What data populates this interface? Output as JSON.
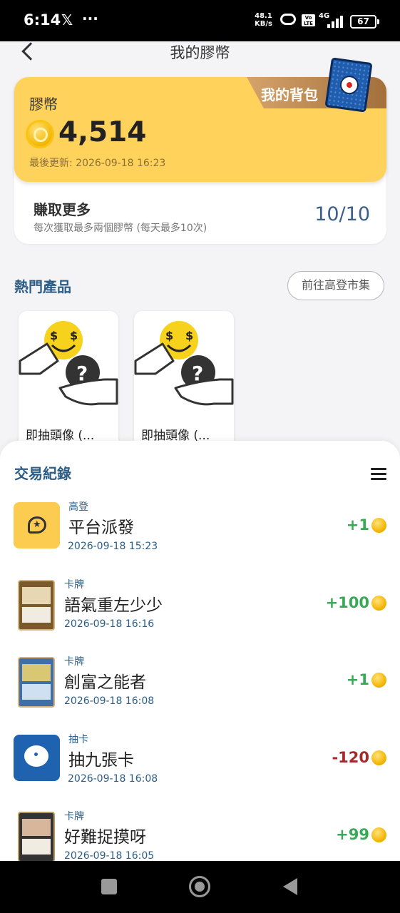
{
  "status_bar": {
    "time": "6:14",
    "net_speed": "48.1",
    "net_unit": "KB/s",
    "volte": "Vo LTE",
    "network": "4G",
    "battery": "67"
  },
  "header": {
    "title": "我的膠幣"
  },
  "coin_card": {
    "label": "膠幣",
    "balance": "4,514",
    "updated": "最後更新: 2026-09-18 16:23",
    "bag_label": "我的背包",
    "earn_title": "賺取更多",
    "earn_sub": "每次獲取最多兩個膠幣 (每天最多10次)",
    "earn_count": "10/10"
  },
  "hot": {
    "title": "熱門產品",
    "market_button": "前往高登市集",
    "products": [
      {
        "name": "即抽頭像 (..."
      },
      {
        "name": "即抽頭像 (..."
      }
    ]
  },
  "transactions": {
    "title": "交易紀錄",
    "items": [
      {
        "category": "高登",
        "name": "平台派發",
        "date": "2026-09-18 15:23",
        "amount": "+1",
        "amount_color": "#3aa957"
      },
      {
        "category": "卡牌",
        "name": "語氣重左少少",
        "date": "2026-09-18 16:16",
        "amount": "+100",
        "amount_color": "#3aa957"
      },
      {
        "category": "卡牌",
        "name": "創富之能者",
        "date": "2026-09-18 16:08",
        "amount": "+1",
        "amount_color": "#3aa957"
      },
      {
        "category": "抽卡",
        "name": "抽九張卡",
        "date": "2026-09-18 16:08",
        "amount": "-120",
        "amount_color": "#a52a2a"
      },
      {
        "category": "卡牌",
        "name": "好難捉摸呀",
        "date": "2026-09-18 16:05",
        "amount": "+99",
        "amount_color": "#3aa957"
      }
    ]
  },
  "colors": {
    "coin_card_bg": "#fed25b",
    "accent_blue": "#2c5d86",
    "positive": "#3aa957",
    "negative": "#a52a2a"
  },
  "icons": [
    "back-icon",
    "coin-icon",
    "menu-icon",
    "x-logo-icon",
    "battery-icon",
    "signal-icon"
  ]
}
